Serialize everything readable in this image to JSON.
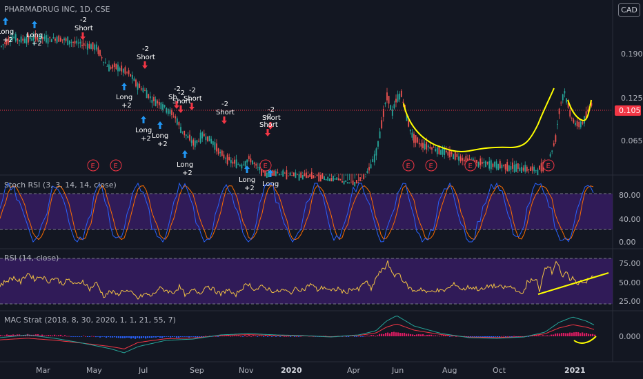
{
  "chart_data": [
    {
      "type": "candlestick",
      "title": "PHARMADRUG INC, 1D, CSE",
      "currency": "CAD",
      "y_ticks": [
        "0.190",
        "0.125",
        "0.065"
      ],
      "last_price": "0.105",
      "x_ticks": [
        "Mar",
        "May",
        "Jul",
        "Sep",
        "Nov",
        "2020",
        "Apr",
        "Jun",
        "Aug",
        "Oct",
        "2021"
      ],
      "price_path": [
        [
          0,
          0.205
        ],
        [
          8,
          0.218
        ],
        [
          18,
          0.235
        ],
        [
          28,
          0.225
        ],
        [
          40,
          0.228
        ],
        [
          55,
          0.232
        ],
        [
          70,
          0.228
        ],
        [
          85,
          0.23
        ],
        [
          100,
          0.222
        ],
        [
          115,
          0.215
        ],
        [
          125,
          0.212
        ],
        [
          140,
          0.205
        ],
        [
          150,
          0.175
        ],
        [
          158,
          0.16
        ],
        [
          168,
          0.162
        ],
        [
          178,
          0.155
        ],
        [
          188,
          0.148
        ],
        [
          198,
          0.13
        ],
        [
          210,
          0.12
        ],
        [
          220,
          0.108
        ],
        [
          232,
          0.103
        ],
        [
          242,
          0.096
        ],
        [
          255,
          0.086
        ],
        [
          262,
          0.075
        ],
        [
          272,
          0.068
        ],
        [
          282,
          0.062
        ],
        [
          295,
          0.07
        ],
        [
          308,
          0.064
        ],
        [
          320,
          0.055
        ],
        [
          335,
          0.05
        ],
        [
          350,
          0.048
        ],
        [
          362,
          0.052
        ],
        [
          372,
          0.047
        ],
        [
          385,
          0.043
        ],
        [
          398,
          0.044
        ],
        [
          410,
          0.043
        ],
        [
          430,
          0.042
        ],
        [
          450,
          0.042
        ],
        [
          470,
          0.041
        ],
        [
          490,
          0.04
        ],
        [
          510,
          0.038
        ],
        [
          525,
          0.04
        ],
        [
          535,
          0.045
        ],
        [
          545,
          0.055
        ],
        [
          552,
          0.075
        ],
        [
          558,
          0.1
        ],
        [
          562,
          0.115
        ],
        [
          568,
          0.09
        ],
        [
          576,
          0.11
        ],
        [
          582,
          0.115
        ],
        [
          590,
          0.085
        ],
        [
          598,
          0.068
        ],
        [
          610,
          0.062
        ],
        [
          625,
          0.06
        ],
        [
          640,
          0.057
        ],
        [
          660,
          0.054
        ],
        [
          680,
          0.05
        ],
        [
          700,
          0.049
        ],
        [
          720,
          0.048
        ],
        [
          740,
          0.047
        ],
        [
          760,
          0.046
        ],
        [
          780,
          0.045
        ],
        [
          795,
          0.05
        ],
        [
          805,
          0.065
        ],
        [
          812,
          0.1
        ],
        [
          818,
          0.12
        ],
        [
          826,
          0.09
        ],
        [
          836,
          0.078
        ],
        [
          846,
          0.082
        ],
        [
          855,
          0.098
        ],
        [
          860,
          0.108
        ]
      ],
      "signals": [
        {
          "type": "long",
          "label": "Long",
          "sub": "+2"
        },
        {
          "type": "long",
          "label": "Long",
          "sub": "+2"
        },
        {
          "type": "short",
          "label": "Short",
          "sub": "-2"
        },
        {
          "type": "long",
          "label": "Long",
          "sub": "+2"
        },
        {
          "type": "long",
          "label": "Long",
          "sub": "+2"
        },
        {
          "type": "short",
          "label": "Short",
          "sub": "-2"
        },
        {
          "type": "short",
          "label": "Short",
          "sub": "-2"
        },
        {
          "type": "long",
          "label": "Long",
          "sub": "+2"
        },
        {
          "type": "long",
          "label": "Long",
          "sub": "+2"
        },
        {
          "type": "short",
          "label": "Short",
          "sub": "-2"
        },
        {
          "type": "short",
          "label": "Sh",
          "sub": "-2"
        },
        {
          "type": "short",
          "label": "Short",
          "sub": "-2"
        },
        {
          "type": "long",
          "label": "Long",
          "sub": "+2"
        },
        {
          "type": "short",
          "label": "Short",
          "sub": "-2"
        },
        {
          "type": "short",
          "label": "Short",
          "sub": "-2"
        },
        {
          "type": "long",
          "label": "Long",
          "sub": ""
        }
      ],
      "earnings_marker": "E",
      "annotations": [
        "cup-and-handle drawing (yellow)"
      ]
    },
    {
      "type": "line",
      "title": "Stoch RSI (3, 3, 14, 14, close)",
      "y_ticks": [
        "80.00",
        "40.00",
        "0.00"
      ],
      "band": [
        20,
        80
      ],
      "ylim": [
        -5,
        100
      ]
    },
    {
      "type": "line",
      "title": "RSI (14, close)",
      "y_ticks": [
        "75.00",
        "50.00",
        "25.00"
      ],
      "band": [
        22,
        78
      ],
      "ylim": [
        15,
        85
      ],
      "rsi_path": [
        [
          0,
          50
        ],
        [
          10,
          56
        ],
        [
          20,
          60
        ],
        [
          30,
          54
        ],
        [
          40,
          66
        ],
        [
          50,
          58
        ],
        [
          60,
          62
        ],
        [
          70,
          55
        ],
        [
          80,
          60
        ],
        [
          90,
          52
        ],
        [
          100,
          57
        ],
        [
          110,
          50
        ],
        [
          120,
          56
        ],
        [
          130,
          45
        ],
        [
          140,
          53
        ],
        [
          150,
          36
        ],
        [
          160,
          42
        ],
        [
          170,
          38
        ],
        [
          180,
          44
        ],
        [
          190,
          40
        ],
        [
          200,
          33
        ],
        [
          210,
          39
        ],
        [
          220,
          36
        ],
        [
          230,
          46
        ],
        [
          240,
          44
        ],
        [
          250,
          40
        ],
        [
          260,
          48
        ],
        [
          270,
          36
        ],
        [
          280,
          44
        ],
        [
          290,
          40
        ],
        [
          300,
          50
        ],
        [
          310,
          44
        ],
        [
          320,
          38
        ],
        [
          330,
          45
        ],
        [
          340,
          36
        ],
        [
          350,
          46
        ],
        [
          360,
          52
        ],
        [
          370,
          44
        ],
        [
          380,
          48
        ],
        [
          390,
          45
        ],
        [
          400,
          41
        ],
        [
          410,
          44
        ],
        [
          420,
          40
        ],
        [
          430,
          46
        ],
        [
          440,
          44
        ],
        [
          450,
          52
        ],
        [
          460,
          44
        ],
        [
          470,
          48
        ],
        [
          480,
          42
        ],
        [
          490,
          46
        ],
        [
          500,
          40
        ],
        [
          510,
          46
        ],
        [
          520,
          44
        ],
        [
          525,
          50
        ],
        [
          530,
          56
        ],
        [
          538,
          44
        ],
        [
          545,
          60
        ],
        [
          552,
          68
        ],
        [
          558,
          72
        ],
        [
          562,
          82
        ],
        [
          566,
          70
        ],
        [
          570,
          62
        ],
        [
          578,
          66
        ],
        [
          585,
          55
        ],
        [
          592,
          48
        ],
        [
          600,
          42
        ],
        [
          610,
          46
        ],
        [
          620,
          40
        ],
        [
          630,
          44
        ],
        [
          640,
          42
        ],
        [
          650,
          46
        ],
        [
          660,
          52
        ],
        [
          670,
          44
        ],
        [
          680,
          48
        ],
        [
          690,
          46
        ],
        [
          700,
          44
        ],
        [
          710,
          50
        ],
        [
          720,
          48
        ],
        [
          730,
          47
        ],
        [
          740,
          48
        ],
        [
          750,
          44
        ],
        [
          755,
          36
        ],
        [
          760,
          44
        ],
        [
          765,
          56
        ],
        [
          770,
          56
        ],
        [
          778,
          56
        ],
        [
          782,
          40
        ],
        [
          786,
          62
        ],
        [
          790,
          72
        ],
        [
          795,
          78
        ],
        [
          800,
          66
        ],
        [
          806,
          82
        ],
        [
          810,
          76
        ],
        [
          815,
          56
        ],
        [
          820,
          68
        ],
        [
          825,
          58
        ],
        [
          830,
          60
        ],
        [
          836,
          52
        ],
        [
          842,
          56
        ],
        [
          848,
          54
        ],
        [
          855,
          58
        ],
        [
          860,
          62
        ]
      ]
    },
    {
      "type": "histogram",
      "title": "MAC Strat (2018, 8, 30, 2020, 1, 1, 21, 55, 7)",
      "y_ticks": [
        "0.000"
      ]
    }
  ],
  "colors": {
    "background": "#131722",
    "band": "#3b1d6b",
    "stoch_k": "#2962ff",
    "stoch_d": "#ff6d00",
    "rsi": "#f5c543",
    "long": "#2196f3",
    "short": "#f23645",
    "up": "#26a69a",
    "down": "#ef5350",
    "drawing": "#ffff00",
    "price_tag": "#f23645"
  }
}
